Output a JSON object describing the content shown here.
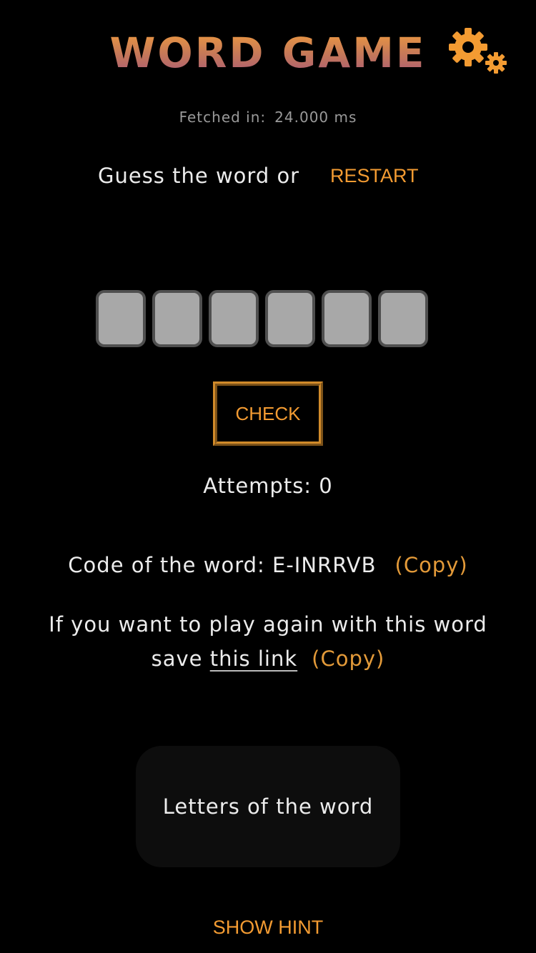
{
  "header": {
    "title": "WORD GAME",
    "settings_icon": "gears-icon"
  },
  "status": {
    "fetched_label": "Fetched in:",
    "fetched_value": "24.000 ms"
  },
  "prompt": {
    "text": "Guess the word or",
    "restart_label": "RESTART"
  },
  "guess": {
    "letter_count": 6,
    "letters": [
      "",
      "",
      "",
      "",
      "",
      ""
    ]
  },
  "check_label": "CHECK",
  "attempts": {
    "label": "Attempts:",
    "value": "0"
  },
  "code": {
    "label": "Code of the word:",
    "value": "E-INRRVB",
    "copy_label": "(Copy)"
  },
  "replay": {
    "line1": "If you want to play again with this word",
    "prefix": "save",
    "link_label": "this link",
    "copy_label": "(Copy)"
  },
  "letters_panel": {
    "label": "Letters of the word"
  },
  "hint_label": "SHOW HINT",
  "colors": {
    "accent": "#f39b32",
    "background": "#000000",
    "text": "#ececec",
    "box_fill": "#a8a8a8",
    "box_border": "#4f4f4f",
    "title_gradient_top": "#f7a13a",
    "title_gradient_bottom": "#a4557b"
  }
}
